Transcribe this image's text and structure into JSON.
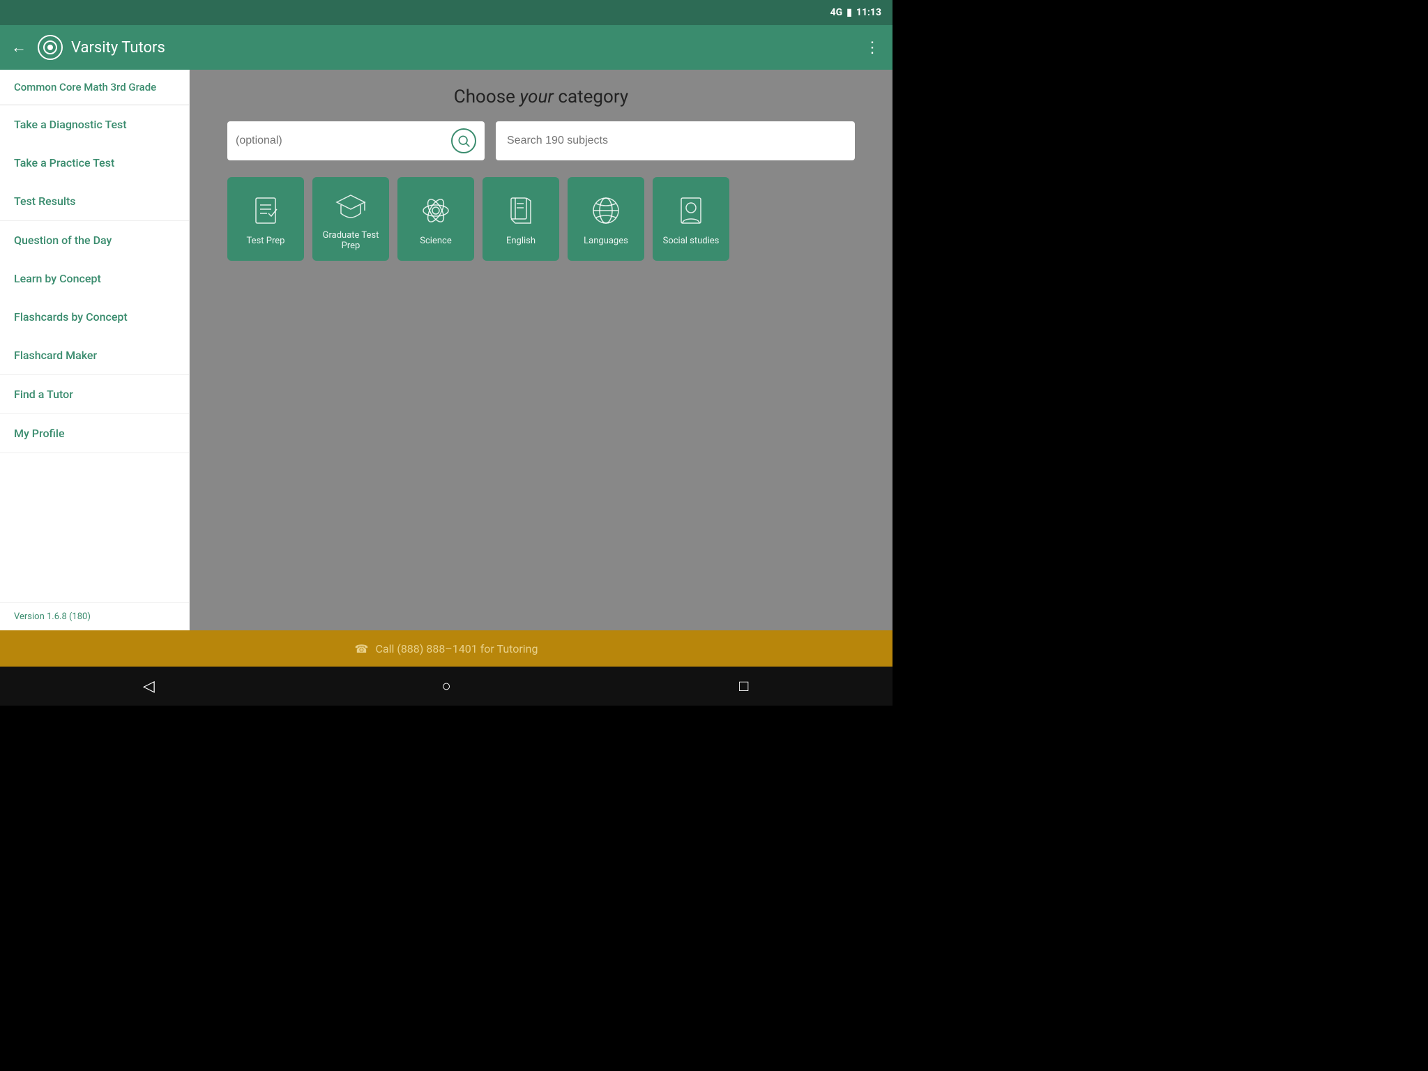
{
  "statusBar": {
    "signal": "4G",
    "battery": "🔋",
    "time": "11:13"
  },
  "appBar": {
    "title": "Varsity Tutors",
    "backIcon": "←",
    "menuIcon": "⋮"
  },
  "sidebar": {
    "headerLabel": "Common Core Math 3rd Grade",
    "groups": [
      {
        "items": [
          {
            "label": "Take a Diagnostic Test",
            "name": "take-diagnostic-test"
          },
          {
            "label": "Take a Practice Test",
            "name": "take-practice-test"
          },
          {
            "label": "Test Results",
            "name": "test-results"
          }
        ]
      },
      {
        "items": [
          {
            "label": "Question of the Day",
            "name": "question-of-the-day"
          },
          {
            "label": "Learn by Concept",
            "name": "learn-by-concept"
          },
          {
            "label": "Flashcards by Concept",
            "name": "flashcards-by-concept"
          },
          {
            "label": "Flashcard Maker",
            "name": "flashcard-maker"
          }
        ]
      },
      {
        "items": [
          {
            "label": "Find a Tutor",
            "name": "find-a-tutor"
          }
        ]
      },
      {
        "items": [
          {
            "label": "My Profile",
            "name": "my-profile"
          }
        ]
      }
    ],
    "versionLabel": "Version 1.6.8 (180)"
  },
  "content": {
    "title": "Choose ",
    "titleItalic": "your",
    "titleSuffix": " category",
    "searchPlaceholder": "(optional)",
    "subjectSearchPlaceholder": "Search 190 subjects",
    "categories": [
      {
        "label": "Test Prep",
        "icon": "checklist",
        "name": "test-prep"
      },
      {
        "label": "Graduate Test Prep",
        "icon": "graduation",
        "name": "graduate-test-prep"
      },
      {
        "label": "Science",
        "icon": "atom",
        "name": "science"
      },
      {
        "label": "English",
        "icon": "book",
        "name": "english"
      },
      {
        "label": "Languages",
        "icon": "globe",
        "name": "languages"
      },
      {
        "label": "Social studies",
        "icon": "person-card",
        "name": "social-studies"
      }
    ]
  },
  "goldBar": {
    "phoneIcon": "☎",
    "text": "Call (888) 888–1401 for Tutoring"
  },
  "bottomNav": {
    "backIcon": "◁",
    "homeIcon": "○",
    "squareIcon": "□"
  }
}
